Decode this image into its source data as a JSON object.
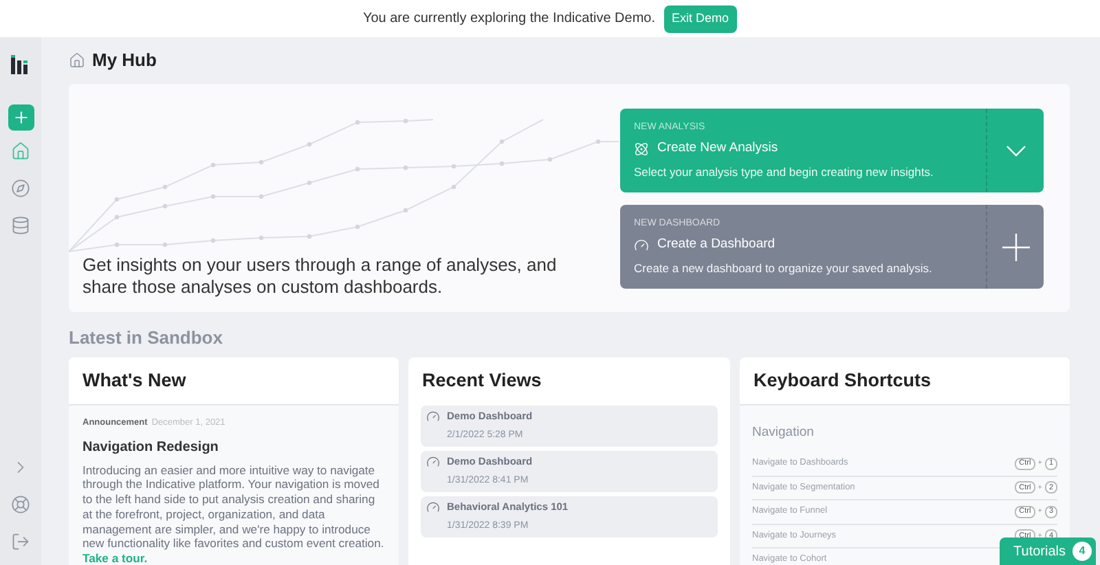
{
  "banner": {
    "message": "You are currently exploring the Indicative Demo.",
    "button": "Exit Demo"
  },
  "sidebar": {
    "top": [
      {
        "kind": "home",
        "selected": true
      },
      {
        "kind": "explore",
        "selected": false
      },
      {
        "kind": "data",
        "selected": false
      }
    ],
    "bottom": [
      {
        "kind": "expand"
      },
      {
        "kind": "help"
      },
      {
        "kind": "logout"
      }
    ]
  },
  "page": {
    "title": "My Hub"
  },
  "hero": {
    "text": "Get insights on your users through a range of analyses, and share those analyses on custom dashboards.",
    "actions": [
      {
        "kind": "analysis",
        "label": "NEW ANALYSIS",
        "title": "Create New Analysis",
        "description": "Select your analysis type and begin creating new insights."
      },
      {
        "kind": "dashboard",
        "label": "NEW DASHBOARD",
        "title": "Create a Dashboard",
        "description": "Create a new dashboard to organize your saved analysis."
      }
    ]
  },
  "section_title": "Latest in Sandbox",
  "whats_new": {
    "title": "What's New",
    "posts": [
      {
        "tag": "Announcement",
        "date": "December 1, 2021",
        "title": "Navigation Redesign",
        "body": "Introducing an easier and more intuitive way to navigate through the Indicative platform. Your navigation is moved to the left hand side to put analysis creation and sharing at the forefront, project, organization, and data management are simpler, and we're happy to introduce new functionality like favorites and custom event creation.",
        "link": "Take a tour."
      }
    ]
  },
  "recent_views": {
    "title": "Recent Views",
    "items": [
      {
        "name": "Demo Dashboard",
        "time": "2/1/2022 5:28 PM"
      },
      {
        "name": "Demo Dashboard",
        "time": "1/31/2022 8:41 PM"
      },
      {
        "name": "Behavioral Analytics 101",
        "time": "1/31/2022 8:39 PM"
      }
    ]
  },
  "shortcuts": {
    "title": "Keyboard Shortcuts",
    "group": "Navigation",
    "items": [
      {
        "label": "Navigate to Dashboards",
        "keys": [
          "Ctrl",
          "+",
          "1"
        ]
      },
      {
        "label": "Navigate to Segmentation",
        "keys": [
          "Ctrl",
          "+",
          "2"
        ]
      },
      {
        "label": "Navigate to Funnel",
        "keys": [
          "Ctrl",
          "+",
          "3"
        ]
      },
      {
        "label": "Navigate to Journeys",
        "keys": [
          "Ctrl",
          "+",
          "4"
        ]
      },
      {
        "label": "Navigate to Cohort"
      }
    ]
  },
  "tutorials": {
    "label": "Tutorials",
    "count": "4"
  }
}
